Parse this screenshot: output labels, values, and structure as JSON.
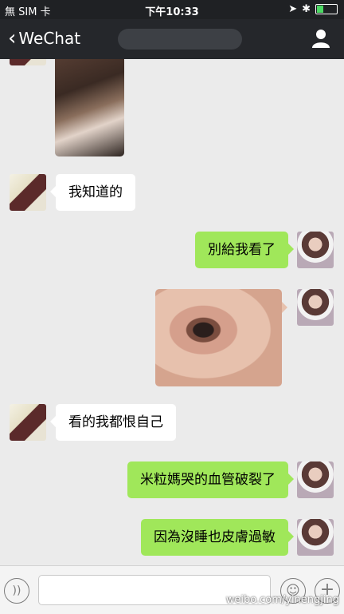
{
  "status_bar": {
    "carrier": "無 SIM 卡",
    "time": "下午10:33"
  },
  "nav": {
    "back_label": "WeChat",
    "title": ""
  },
  "messages": [
    {
      "side": "left",
      "type": "image",
      "desc_icon": "baby-photo"
    },
    {
      "side": "left",
      "type": "text",
      "text": "我知道的"
    },
    {
      "side": "right",
      "type": "text",
      "text": "別給我看了"
    },
    {
      "side": "right",
      "type": "image",
      "desc_icon": "eye-photo"
    },
    {
      "side": "left",
      "type": "text",
      "text": "看的我都恨自己"
    },
    {
      "side": "right",
      "type": "text",
      "text": "米粒媽哭的血管破裂了"
    },
    {
      "side": "right",
      "type": "text",
      "text": "因為沒睡也皮膚過敏"
    }
  ],
  "input": {
    "placeholder": ""
  },
  "watermark": "weibo.com/yinengjing",
  "colors": {
    "navbar": "#25272b",
    "background": "#ebebeb",
    "sent_bubble": "#a0e75a",
    "received_bubble": "#ffffff"
  }
}
